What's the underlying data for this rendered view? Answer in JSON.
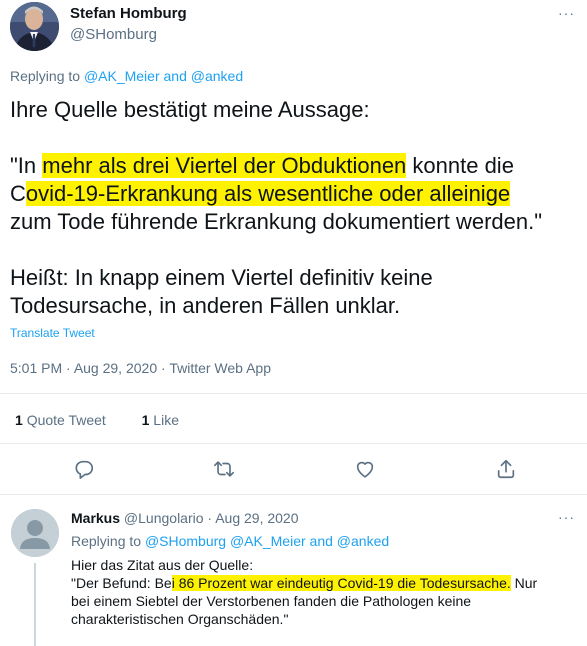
{
  "main_tweet": {
    "author_name": "Stefan Homburg",
    "handle": "@SHomburg",
    "menu": "···",
    "replying_prefix": "Replying to ",
    "replying_user1": "@AK_Meier",
    "replying_and": " and ",
    "replying_user2": "@anked",
    "body": {
      "line1": "Ihre Quelle bestätigt meine Aussage:",
      "q_a": "\"In ",
      "q_b": "mehr als drei Viertel der Obduktionen",
      "q_c": " konnte die",
      "q_d": "C",
      "q_e": "ovid-19-Erkrankung als wesentliche oder alleinige",
      "q_f": "zum Tode führende Erkrankung dokumentiert werden.\"",
      "p3_line1": "Heißt: In knapp einem Viertel definitiv keine",
      "p3_line2": "Todesursache, in anderen Fällen unklar."
    },
    "translate_label": "Translate Tweet",
    "time": "5:01 PM",
    "sep": " · ",
    "date": "Aug 29, 2020",
    "source": "Twitter Web App",
    "stats": {
      "quote_count": "1",
      "quote_label": "Quote Tweet",
      "like_count": "1",
      "like_label": "Like"
    },
    "icons": [
      "reply-icon",
      "retweet-icon",
      "like-icon",
      "share-icon"
    ]
  },
  "reply_tweet": {
    "author_name": "Markus",
    "handle": "@Lungolario",
    "sep": " · ",
    "date": "Aug 29, 2020",
    "menu": "···",
    "replying_prefix": "Replying to ",
    "replying_user1": "@SHomburg",
    "replying_user2": "@AK_Meier",
    "replying_and": " and ",
    "replying_user3": "@anked",
    "body": {
      "line1": "Hier das Zitat aus der Quelle:",
      "q_a": "\"Der Befund: Be",
      "q_b": "i 86 Prozent war eindeutig Covid-19 die Todesursache.",
      "q_c": " Nur",
      "line3": "bei einem Siebtel der Verstorbenen fanden die Pathologen keine",
      "line4": "charakteristischen Organschäden.\""
    }
  },
  "colors": {
    "accent": "#1da1f2",
    "muted": "#5b7083",
    "highlight": "#fff200",
    "text": "#0f1419"
  }
}
